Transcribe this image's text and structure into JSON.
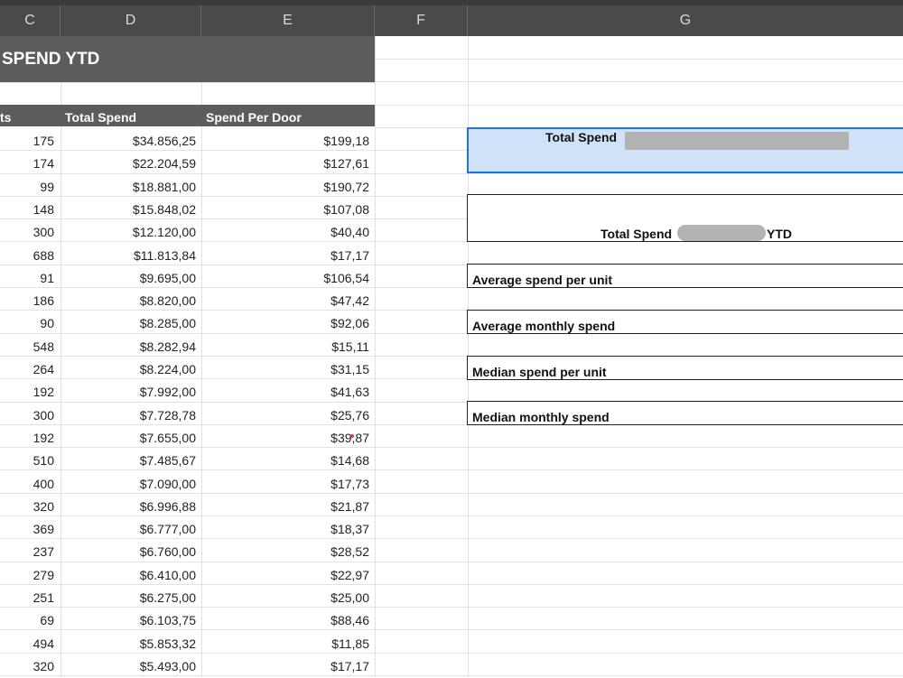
{
  "columns": [
    "C",
    "D",
    "E",
    "F",
    "G"
  ],
  "title": "SPEND YTD",
  "table_headers": {
    "c": "ts",
    "d": "Total Spend",
    "e": "Spend Per Door"
  },
  "rows": [
    [
      "175",
      "$34.856,25",
      "$199,18"
    ],
    [
      "174",
      "$22.204,59",
      "$127,61"
    ],
    [
      "99",
      "$18.881,00",
      "$190,72"
    ],
    [
      "148",
      "$15.848,02",
      "$107,08"
    ],
    [
      "300",
      "$12.120,00",
      "$40,40"
    ],
    [
      "688",
      "$11.813,84",
      "$17,17"
    ],
    [
      "91",
      "$9.695,00",
      "$106,54"
    ],
    [
      "186",
      "$8.820,00",
      "$47,42"
    ],
    [
      "90",
      "$8.285,00",
      "$92,06"
    ],
    [
      "548",
      "$8.282,94",
      "$15,11"
    ],
    [
      "264",
      "$8.224,00",
      "$31,15"
    ],
    [
      "192",
      "$7.992,00",
      "$41,63"
    ],
    [
      "300",
      "$7.728,78",
      "$25,76"
    ],
    [
      "192",
      "$7.655,00",
      "$39,87"
    ],
    [
      "510",
      "$7.485,67",
      "$14,68"
    ],
    [
      "400",
      "$7.090,00",
      "$17,73"
    ],
    [
      "320",
      "$6.996,88",
      "$21,87"
    ],
    [
      "369",
      "$6.777,00",
      "$18,37"
    ],
    [
      "237",
      "$6.760,00",
      "$28,52"
    ],
    [
      "279",
      "$6.410,00",
      "$22,97"
    ],
    [
      "251",
      "$6.275,00",
      "$25,00"
    ],
    [
      "69",
      "$6.103,75",
      "$88,46"
    ],
    [
      "494",
      "$5.853,32",
      "$11,85"
    ],
    [
      "320",
      "$5.493,00",
      "$17,17"
    ]
  ],
  "summary": {
    "selected_label": "Total Spend",
    "ytd_label_prefix": "Total Spend",
    "ytd_label_suffix": "YTD",
    "avg_spend_unit": "Average spend per unit",
    "avg_monthly": "Average monthly spend",
    "median_spend_unit": "Median spend per unit",
    "median_monthly": "Median monthly spend"
  },
  "colors": {
    "header_dark": "#4a4a4a",
    "band": "#5c5c5c",
    "selection_fill": "#cfe2f8",
    "selection_border": "#1a73e8"
  }
}
